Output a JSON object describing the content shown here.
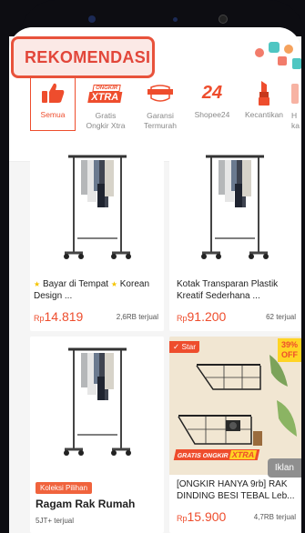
{
  "header": {
    "tab_label": "REKOMENDASI"
  },
  "categories": [
    {
      "label": "Semua",
      "icon": "thumbs-up-icon",
      "active": true
    },
    {
      "label": "Gratis\nOngkir Xtra",
      "icon": "ongkir-xtra-icon",
      "active": false,
      "icon_text": "XTRA",
      "icon_subtext": "ONGKIR"
    },
    {
      "label": "Garansi\nTermurah",
      "icon": "garansi-termurah-icon",
      "active": false,
      "icon_text": "TERMURAH"
    },
    {
      "label": "Shopee24",
      "icon": "shopee24-icon",
      "active": false,
      "icon_text": "24"
    },
    {
      "label": "Kecantikan",
      "icon": "lipstick-icon",
      "active": false
    },
    {
      "label": "H\nka",
      "icon": "category-icon",
      "active": false
    }
  ],
  "products": [
    {
      "title_parts": [
        "Bayar di Tempat",
        "Korean Design ..."
      ],
      "price_prefix": "Rp",
      "price": "14.819",
      "sold": "2,6RB terjual"
    },
    {
      "title": "Kotak Transparan Plastik Kreatif Sederhana ...",
      "price_prefix": "Rp",
      "price": "91.200",
      "sold": "62 terjual"
    },
    {
      "badge": "Koleksi Pilihan",
      "title": "Ragam Rak Rumah",
      "subtitle": "5JT+ terjual"
    },
    {
      "star_badge": "Star",
      "discount": "39%",
      "discount_label": "OFF",
      "ongkir_text": "GRATIS ONGKIR",
      "ongkir_xtra": "XTRA",
      "ad_label": "Iklan",
      "title": "[ONGKIR HANYA 9rb] RAK DINDING BESI TEBAL Leb...",
      "price_prefix": "Rp",
      "price": "15.900",
      "sold": "4,7RB terjual"
    }
  ],
  "colors": {
    "brand": "#ee4d2d",
    "highlight_border": "#e8523b"
  }
}
